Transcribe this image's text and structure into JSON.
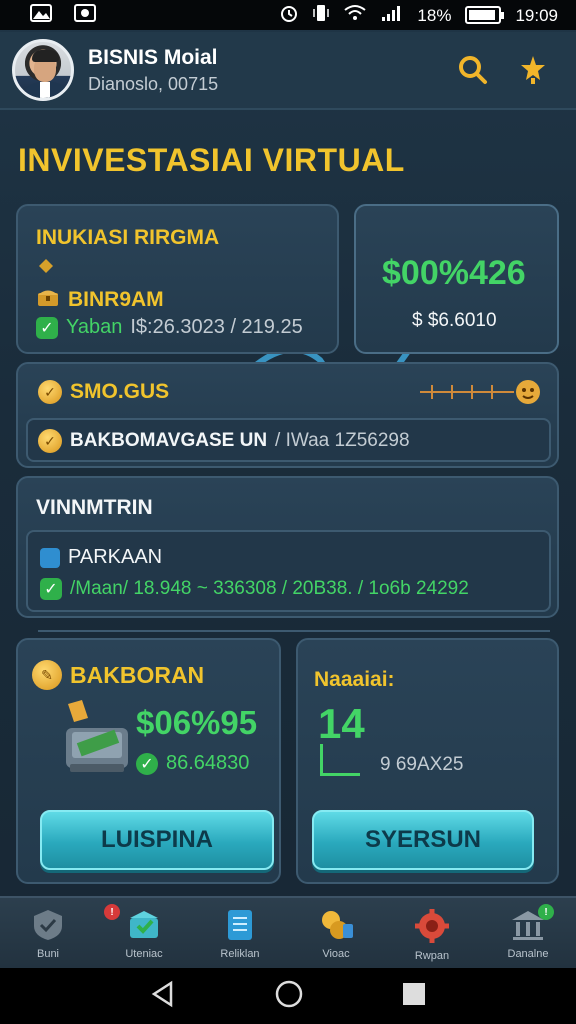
{
  "status_bar": {
    "battery": "18%",
    "time": "19:09"
  },
  "header": {
    "title": "BISNIS Moial",
    "subtitle": "Dianoslo, 00715"
  },
  "section_title": "INVIVESTASIAI VIRTUAL",
  "card_left": {
    "title": "INUKIASI RIRGMA",
    "item_label": "BINR9AM",
    "status_label": "Yaban",
    "status_value": "I$:26.3023 / 219.25"
  },
  "card_right": {
    "big_value": "$00%426",
    "sub_value": "$ $6.6010"
  },
  "card_bonus": {
    "label": "SMO.GUS",
    "row_text": "BAKBOMAVGASE UN",
    "row_value": "/ IWaa 1Z56298"
  },
  "card_wide": {
    "title": "VINNMTRIN",
    "item_label": "PARKAAN",
    "row_text": "/Maan/ 18.948 ~ 336308 / 20B38. / 1o6b 24292"
  },
  "card_bottom_left": {
    "title": "BAKBORAN",
    "value": "$06%95",
    "sub_value": "86.64830",
    "button": "LUISPINA"
  },
  "card_bottom_right": {
    "label": "Naaaiai:",
    "big_number": "14",
    "sub_value": "9 69AX25",
    "button": "SYERSUN"
  },
  "bottom_nav": [
    {
      "label": "Buni"
    },
    {
      "label": "Uteniac"
    },
    {
      "label": "Reliklan"
    },
    {
      "label": "Vioac"
    },
    {
      "label": "Rwpan"
    },
    {
      "label": "Danalne"
    }
  ],
  "colors": {
    "accent_gold": "#f1c42d",
    "accent_green": "#43d466",
    "accent_teal": "#2aa9bd",
    "background": "#1f3546"
  }
}
